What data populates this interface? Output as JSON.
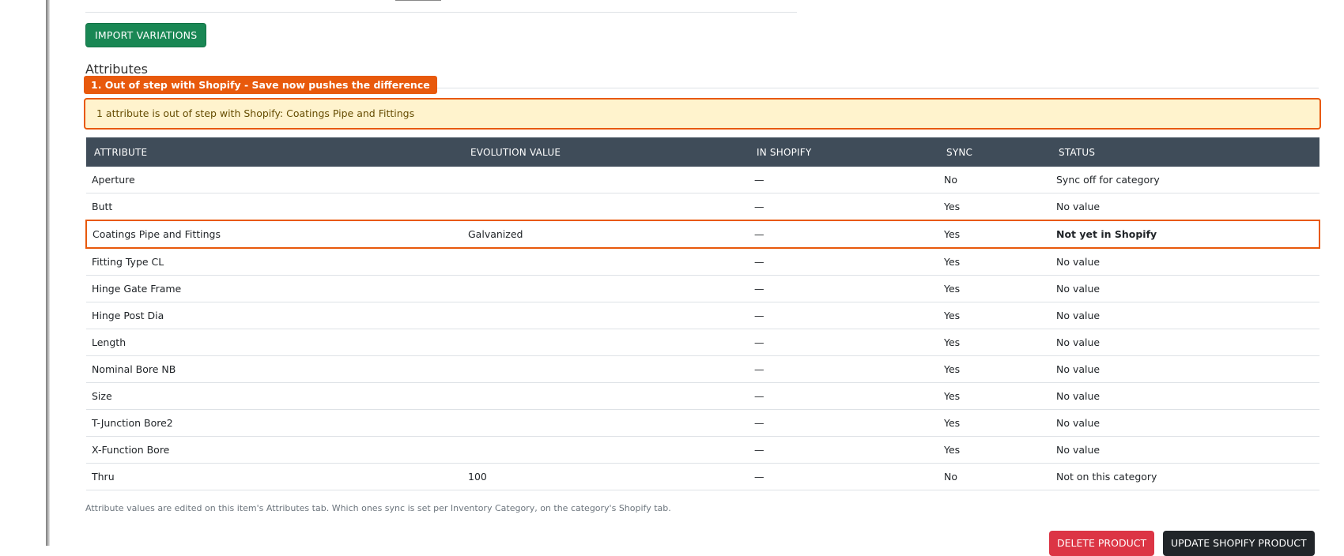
{
  "actions": {
    "import_variations": "IMPORT VARIATIONS",
    "delete_product": "DELETE PRODUCT",
    "update_shopify_product": "UPDATE SHOPIFY PRODUCT"
  },
  "attributes": {
    "section_title": "Attributes",
    "annotation_label": "1. Out of step with Shopify - Save now pushes the difference",
    "alert_text": "1 attribute is out of step with Shopify: Coatings Pipe and Fittings",
    "columns": [
      "ATTRIBUTE",
      "EVOLUTION VALUE",
      "IN SHOPIFY",
      "SYNC",
      "STATUS"
    ],
    "rows": [
      {
        "attribute": "Aperture",
        "evolution_value": "",
        "in_shopify": "—",
        "sync": "No",
        "status": "Sync off for category"
      },
      {
        "attribute": "Butt",
        "evolution_value": "",
        "in_shopify": "—",
        "sync": "Yes",
        "status": "No value"
      },
      {
        "attribute": "Coatings Pipe and Fittings",
        "evolution_value": "Galvanized",
        "in_shopify": "—",
        "sync": "Yes",
        "status": "Not yet in Shopify"
      },
      {
        "attribute": "Fitting Type CL",
        "evolution_value": "",
        "in_shopify": "—",
        "sync": "Yes",
        "status": "No value"
      },
      {
        "attribute": "Hinge Gate Frame",
        "evolution_value": "",
        "in_shopify": "—",
        "sync": "Yes",
        "status": "No value"
      },
      {
        "attribute": "Hinge Post Dia",
        "evolution_value": "",
        "in_shopify": "—",
        "sync": "Yes",
        "status": "No value"
      },
      {
        "attribute": "Length",
        "evolution_value": "",
        "in_shopify": "—",
        "sync": "Yes",
        "status": "No value"
      },
      {
        "attribute": "Nominal Bore NB",
        "evolution_value": "",
        "in_shopify": "—",
        "sync": "Yes",
        "status": "No value"
      },
      {
        "attribute": "Size",
        "evolution_value": "",
        "in_shopify": "—",
        "sync": "Yes",
        "status": "No value"
      },
      {
        "attribute": "T-Junction Bore2",
        "evolution_value": "",
        "in_shopify": "—",
        "sync": "Yes",
        "status": "No value"
      },
      {
        "attribute": "X-Function Bore",
        "evolution_value": "",
        "in_shopify": "—",
        "sync": "Yes",
        "status": "No value"
      },
      {
        "attribute": "Thru",
        "evolution_value": "100",
        "in_shopify": "—",
        "sync": "No",
        "status": "Not on this category"
      }
    ],
    "footnote": "Attribute values are edited on this item's Attributes tab. Which ones sync is set per Inventory Category, on the category's Shopify tab."
  }
}
